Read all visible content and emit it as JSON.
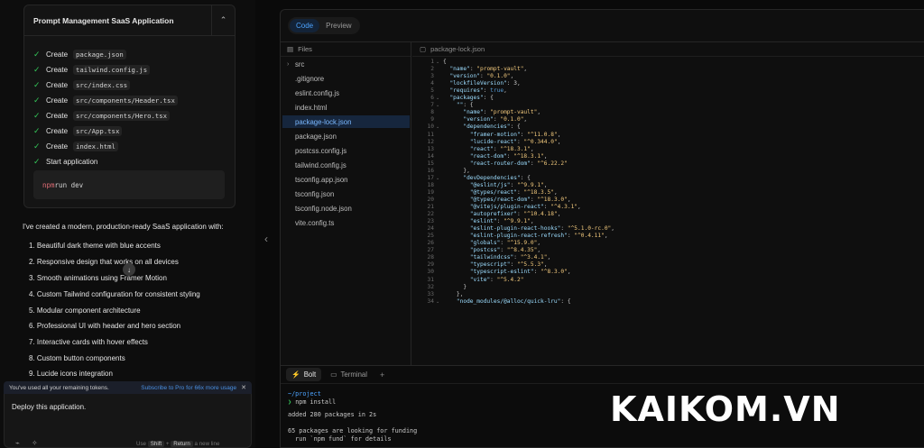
{
  "chat": {
    "artifact": {
      "title": "Prompt Management SaaS Application",
      "steps": [
        {
          "label": "Create",
          "file": "package.json"
        },
        {
          "label": "Create",
          "file": "tailwind.config.js"
        },
        {
          "label": "Create",
          "file": "src/index.css"
        },
        {
          "label": "Create",
          "file": "src/components/Header.tsx"
        },
        {
          "label": "Create",
          "file": "src/components/Hero.tsx"
        },
        {
          "label": "Create",
          "file": "src/App.tsx"
        },
        {
          "label": "Create",
          "file": "index.html"
        },
        {
          "label": "Start application",
          "file": ""
        }
      ],
      "command": {
        "kw": "npm",
        "rest": " run dev"
      }
    },
    "intro": "I've created a modern, production-ready SaaS application with:",
    "list": [
      "1. Beautiful dark theme with blue accents",
      "2. Responsive design that works on all devices",
      "3. Smooth animations using Framer Motion",
      "4. Custom Tailwind configuration for consistent styling",
      "5. Modular component architecture",
      "6. Professional UI with header and hero section",
      "7. Interactive cards with hover effects",
      "8. Custom button components",
      "9. Lucide icons integration"
    ],
    "token_banner": {
      "message": "You've used all your remaining tokens.",
      "link": "Subscribe to Pro for 66x more usage"
    },
    "prompt": {
      "value": "Deploy this application.",
      "hint_use": "Use",
      "hint_key1": "Shift",
      "hint_plus": "+",
      "hint_key2": "Return",
      "hint_tail": "a new line"
    }
  },
  "workbench": {
    "tabs": [
      "Code",
      "Preview"
    ],
    "files_header": "Files",
    "files": [
      "src",
      ".gitignore",
      "eslint.config.js",
      "index.html",
      "package-lock.json",
      "package.json",
      "postcss.config.js",
      "tailwind.config.js",
      "tsconfig.app.json",
      "tsconfig.json",
      "tsconfig.node.json",
      "vite.config.ts"
    ],
    "selected_file": "package-lock.json",
    "editor_tab": "package-lock.json",
    "code_lines": [
      "{",
      "  \"name\": \"prompt-vault\",",
      "  \"version\": \"0.1.0\",",
      "  \"lockfileVersion\": 3,",
      "  \"requires\": true,",
      "  \"packages\": {",
      "    \"\": {",
      "      \"name\": \"prompt-vault\",",
      "      \"version\": \"0.1.0\",",
      "      \"dependencies\": {",
      "        \"framer-motion\": \"^11.0.8\",",
      "        \"lucide-react\": \"^0.344.0\",",
      "        \"react\": \"^18.3.1\",",
      "        \"react-dom\": \"^18.3.1\",",
      "        \"react-router-dom\": \"^6.22.2\"",
      "      },",
      "      \"devDependencies\": {",
      "        \"@eslint/js\": \"^9.9.1\",",
      "        \"@types/react\": \"^18.3.5\",",
      "        \"@types/react-dom\": \"^18.3.0\",",
      "        \"@vitejs/plugin-react\": \"^4.3.1\",",
      "        \"autoprefixer\": \"^10.4.18\",",
      "        \"eslint\": \"^9.9.1\",",
      "        \"eslint-plugin-react-hooks\": \"^5.1.0-rc.0\",",
      "        \"eslint-plugin-react-refresh\": \"^0.4.11\",",
      "        \"globals\": \"^15.9.0\",",
      "        \"postcss\": \"^8.4.35\",",
      "        \"tailwindcss\": \"^3.4.1\",",
      "        \"typescript\": \"^5.5.3\",",
      "        \"typescript-eslint\": \"^8.3.0\",",
      "        \"vite\": \"^5.4.2\"",
      "      }",
      "    },",
      "    \"node_modules/@alloc/quick-lru\": {"
    ],
    "terminal": {
      "tabs": [
        "Bolt",
        "Terminal"
      ],
      "path": "~/project",
      "command": "npm install",
      "output": [
        "added 280 packages in 2s",
        "",
        "65 packages are looking for funding",
        "  run `npm fund` for details"
      ]
    }
  },
  "watermark": "KAIKOM.VN",
  "colors": {
    "accent": "#4ca3ff",
    "success": "#34c759",
    "background": "#0a0a0a"
  }
}
